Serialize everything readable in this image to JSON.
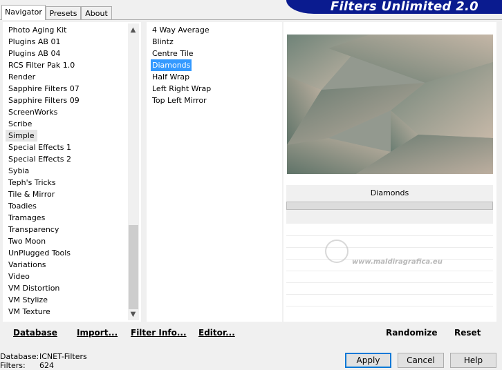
{
  "tabs": [
    "Navigator",
    "Presets",
    "About"
  ],
  "banner_title": "Filters Unlimited 2.0",
  "categories": [
    "Photo Aging Kit",
    "Plugins AB 01",
    "Plugins AB 04",
    "RCS Filter Pak 1.0",
    "Render",
    "Sapphire Filters 07",
    "Sapphire Filters 09",
    "ScreenWorks",
    "Scribe",
    "Simple",
    "Special Effects 1",
    "Special Effects 2",
    "Sybia",
    "Teph's Tricks",
    "Tile & Mirror",
    "Toadies",
    "Tramages",
    "Transparency",
    "Two Moon",
    "UnPlugged Tools",
    "Variations",
    "Video",
    "VM Distortion",
    "VM Stylize",
    "VM Texture"
  ],
  "filters": [
    "4 Way Average",
    "Blintz",
    "Centre Tile",
    "Diamonds",
    "Half Wrap",
    "Left Right Wrap",
    "Top Left Mirror"
  ],
  "selected_filter": "Diamonds",
  "preview_filter_name": "Diamonds",
  "watermark": "www.maldiragrafica.eu",
  "bottom_links": [
    "Database",
    "Import...",
    "Filter Info...",
    "Editor..."
  ],
  "right_buttons": [
    "Randomize",
    "Reset"
  ],
  "status": {
    "database_label": "Database:",
    "database_value": "ICNET-Filters",
    "filters_label": "Filters:",
    "filters_value": "624"
  },
  "dialog_buttons": [
    "Apply",
    "Cancel",
    "Help"
  ],
  "colors": {
    "banner": "#0a1b8f",
    "selection": "#3399ff",
    "default_button_border": "#0078d7"
  }
}
